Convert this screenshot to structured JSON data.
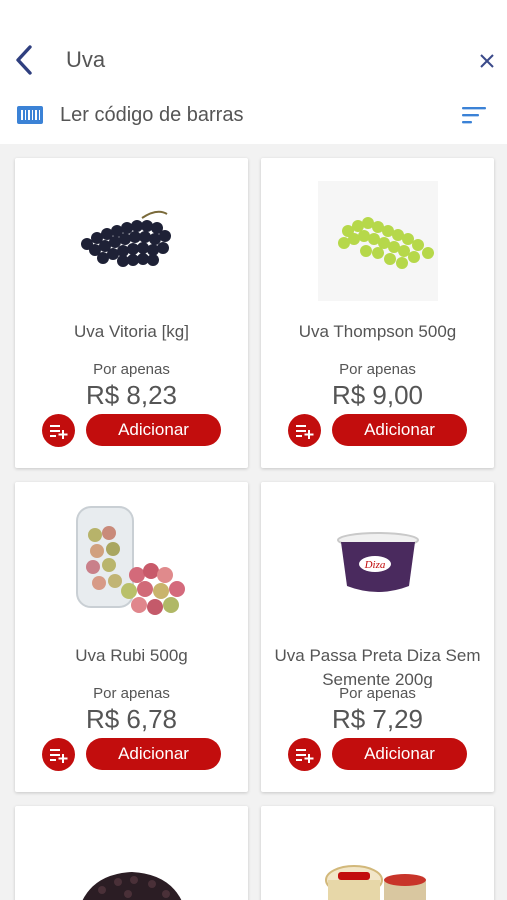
{
  "header": {
    "search_value": "Uva",
    "barcode_label": "Ler código de barras"
  },
  "colors": {
    "accent_red": "#c20d0d",
    "icon_blue": "#3b82d6",
    "back_arrow": "#2f3f7f"
  },
  "products": [
    {
      "name": "Uva Vitoria [kg]",
      "price_label": "Por apenas",
      "price": "R$ 8,23",
      "add_label": "Adicionar",
      "image": "dark-grape-bunch-icon"
    },
    {
      "name": "Uva Thompson 500g",
      "price_label": "Por apenas",
      "price": "R$ 9,00",
      "add_label": "Adicionar",
      "image": "green-grape-bunch-icon"
    },
    {
      "name": "Uva Rubi 500g",
      "price_label": "Por apenas",
      "price": "R$ 6,78",
      "add_label": "Adicionar",
      "image": "red-grape-package-icon"
    },
    {
      "name": "Uva Passa Preta Diza Sem Semente 200g",
      "price_label": "Por apenas",
      "price": "R$ 7,29",
      "add_label": "Adicionar",
      "image": "raisin-jar-icon",
      "brand": "Diza"
    },
    {
      "name": "",
      "price_label": "",
      "price": "",
      "add_label": "",
      "image": "raisins-pile-icon"
    },
    {
      "name": "",
      "price_label": "",
      "price": "",
      "add_label": "",
      "image": "raisin-containers-icon"
    }
  ]
}
